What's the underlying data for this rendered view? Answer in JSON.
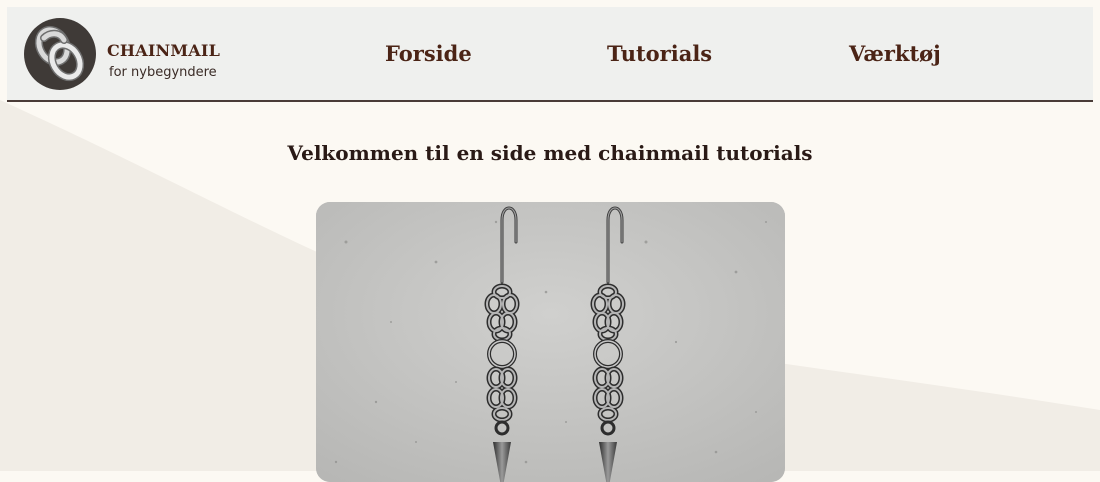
{
  "brand": {
    "title": "CHAINMAIL",
    "subtitle": "for nybegyndere",
    "logo_icon": "chain-links-icon"
  },
  "nav": {
    "items": [
      {
        "label": "Forside"
      },
      {
        "label": "Tutorials"
      },
      {
        "label": "Værktøj"
      }
    ]
  },
  "main": {
    "heading": "Velkommen til en side med chainmail tutorials",
    "hero_image": "chainmail-earrings-photo"
  },
  "colors": {
    "background": "#fcf9f3",
    "header_background": "#eff0ee",
    "accent_dark": "#4b2416",
    "heading_text": "#2a1a16",
    "background_curve": "#f1ede6"
  }
}
